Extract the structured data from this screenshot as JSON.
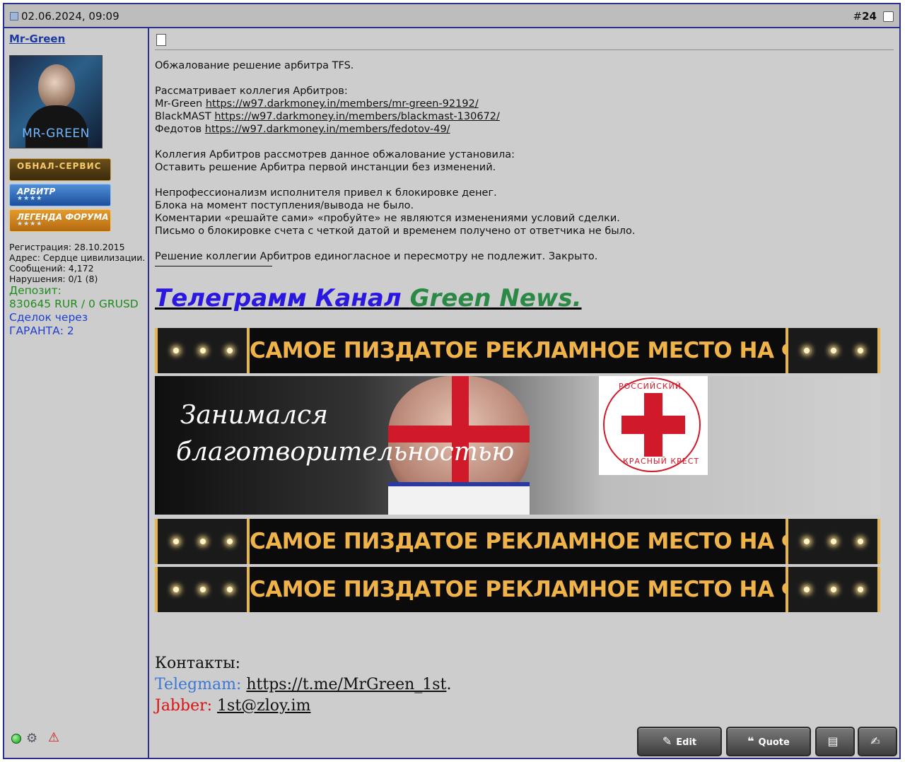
{
  "header": {
    "date": "02.06.2024, 09:09",
    "post_hash": "#",
    "post_number": "24"
  },
  "user": {
    "name": "Mr-Green",
    "avatar_text": "MR-GREEN",
    "ranks": [
      {
        "label": "ОБНАЛ-СЕРВИС",
        "stars": ""
      },
      {
        "label": "АРБИТР",
        "stars": "★★★★"
      },
      {
        "label": "ЛЕГЕНДА ФОРУМА",
        "stars": "★★★★"
      }
    ],
    "registration": "Регистрация: 28.10.2015",
    "address": "Адрес: Сердце цивилизации.",
    "messages": "Сообщений: 4,172",
    "violations": "Нарушения: 0/1 (8)",
    "deposit_label": "Депозит:",
    "deposit_value": "830645 RUR / 0 GRUSD",
    "deals_label": "Сделок через",
    "deals_value": "ГАРАНТА: 2"
  },
  "post": {
    "line1": "Обжалование решение арбитра TFS.",
    "line2": "Рассматривает коллегия Арбитров:",
    "members": [
      {
        "name": "Mr-Green ",
        "link": "https://w97.darkmoney.in/members/mr-green-92192/"
      },
      {
        "name": "BlackMAST ",
        "link": "https://w97.darkmoney.in/members/blackmast-130672/"
      },
      {
        "name": "Федотов ",
        "link": "https://w97.darkmoney.in/members/fedotov-49/"
      }
    ],
    "line3": "Коллегия Арбитров рассмотрев данное обжалование установила:",
    "line4": "Оставить решение Арбитра первой инстанции без изменений.",
    "line5": "Непрофессионализм исполнителя привел к блокировке денег.",
    "line6": "Блока на момент поступления/вывода не было.",
    "line7": "Коментарии «решайте сами» «пробуйте» не являются изменениями условий сделки.",
    "line8": "Письмо о блокировке счета с четкой датой и временем получено от ответчика не было.",
    "line9": "Решение коллегии Арбитров единогласное и пересмотру не подлежит. Закрыто."
  },
  "signature": {
    "tg_part1": "Телеграмм Канал ",
    "tg_part2": "Green News.",
    "banner_text": "САМОЕ ПИЗДАТОЕ РЕКЛАМНОЕ МЕСТО НА ФОРУМЕ",
    "photo_caption1": "Занимался",
    "photo_caption2": "благотворительностью",
    "redcross_top": "РОССИЙСКИЙ",
    "redcross_bottom": "КРАСНЫЙ КРЕСТ",
    "contacts_label": "Контакты:",
    "telegram_label": "Telegmam: ",
    "telegram_link": "https://t.me/MrGreen_1st",
    "telegram_dot": ".",
    "jabber_label": "Jabber: ",
    "jabber_link": "1st@zloy.im"
  },
  "buttons": {
    "edit": "Edit",
    "quote": "Quote"
  },
  "colors": {
    "border": "#2b2f8f",
    "deposit": "#1f8a1f",
    "deals": "#1f3fd0",
    "telegram": "#2a18e0",
    "green_news": "#2a8a45",
    "jabber": "#e01010"
  }
}
